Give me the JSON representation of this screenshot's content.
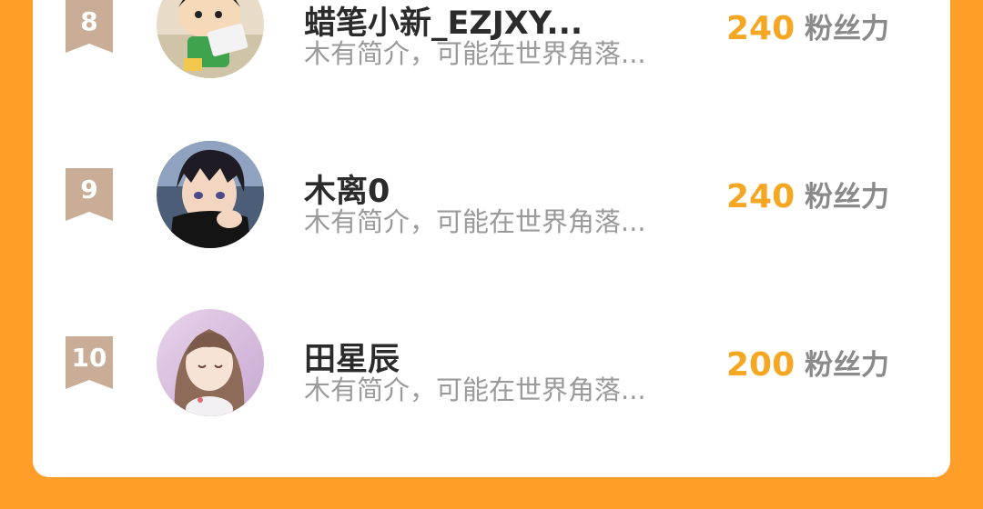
{
  "colors": {
    "page_background": "#FF9F2A",
    "card_background": "#FFFFFF",
    "rank_badge": "#C9AD96",
    "score_value": "#F5A623",
    "score_unit": "#8A8A8A",
    "name_text": "#2B2B2B",
    "bio_text": "#9A9A9A"
  },
  "leaderboard": {
    "rows": [
      {
        "rank": "8",
        "name": "蜡笔小新_EZJXY...",
        "bio": "木有简介，可能在世界角落...",
        "score": "240",
        "score_unit": "粉丝力",
        "avatar_icon": "cartoon-boy-avatar-icon"
      },
      {
        "rank": "9",
        "name": "木离0",
        "bio": "木有简介，可能在世界角落...",
        "score": "240",
        "score_unit": "粉丝力",
        "avatar_icon": "anime-boy-avatar-icon"
      },
      {
        "rank": "10",
        "name": "田星辰",
        "bio": "木有简介，可能在世界角落...",
        "score": "200",
        "score_unit": "粉丝力",
        "avatar_icon": "anime-girl-avatar-icon"
      }
    ]
  }
}
